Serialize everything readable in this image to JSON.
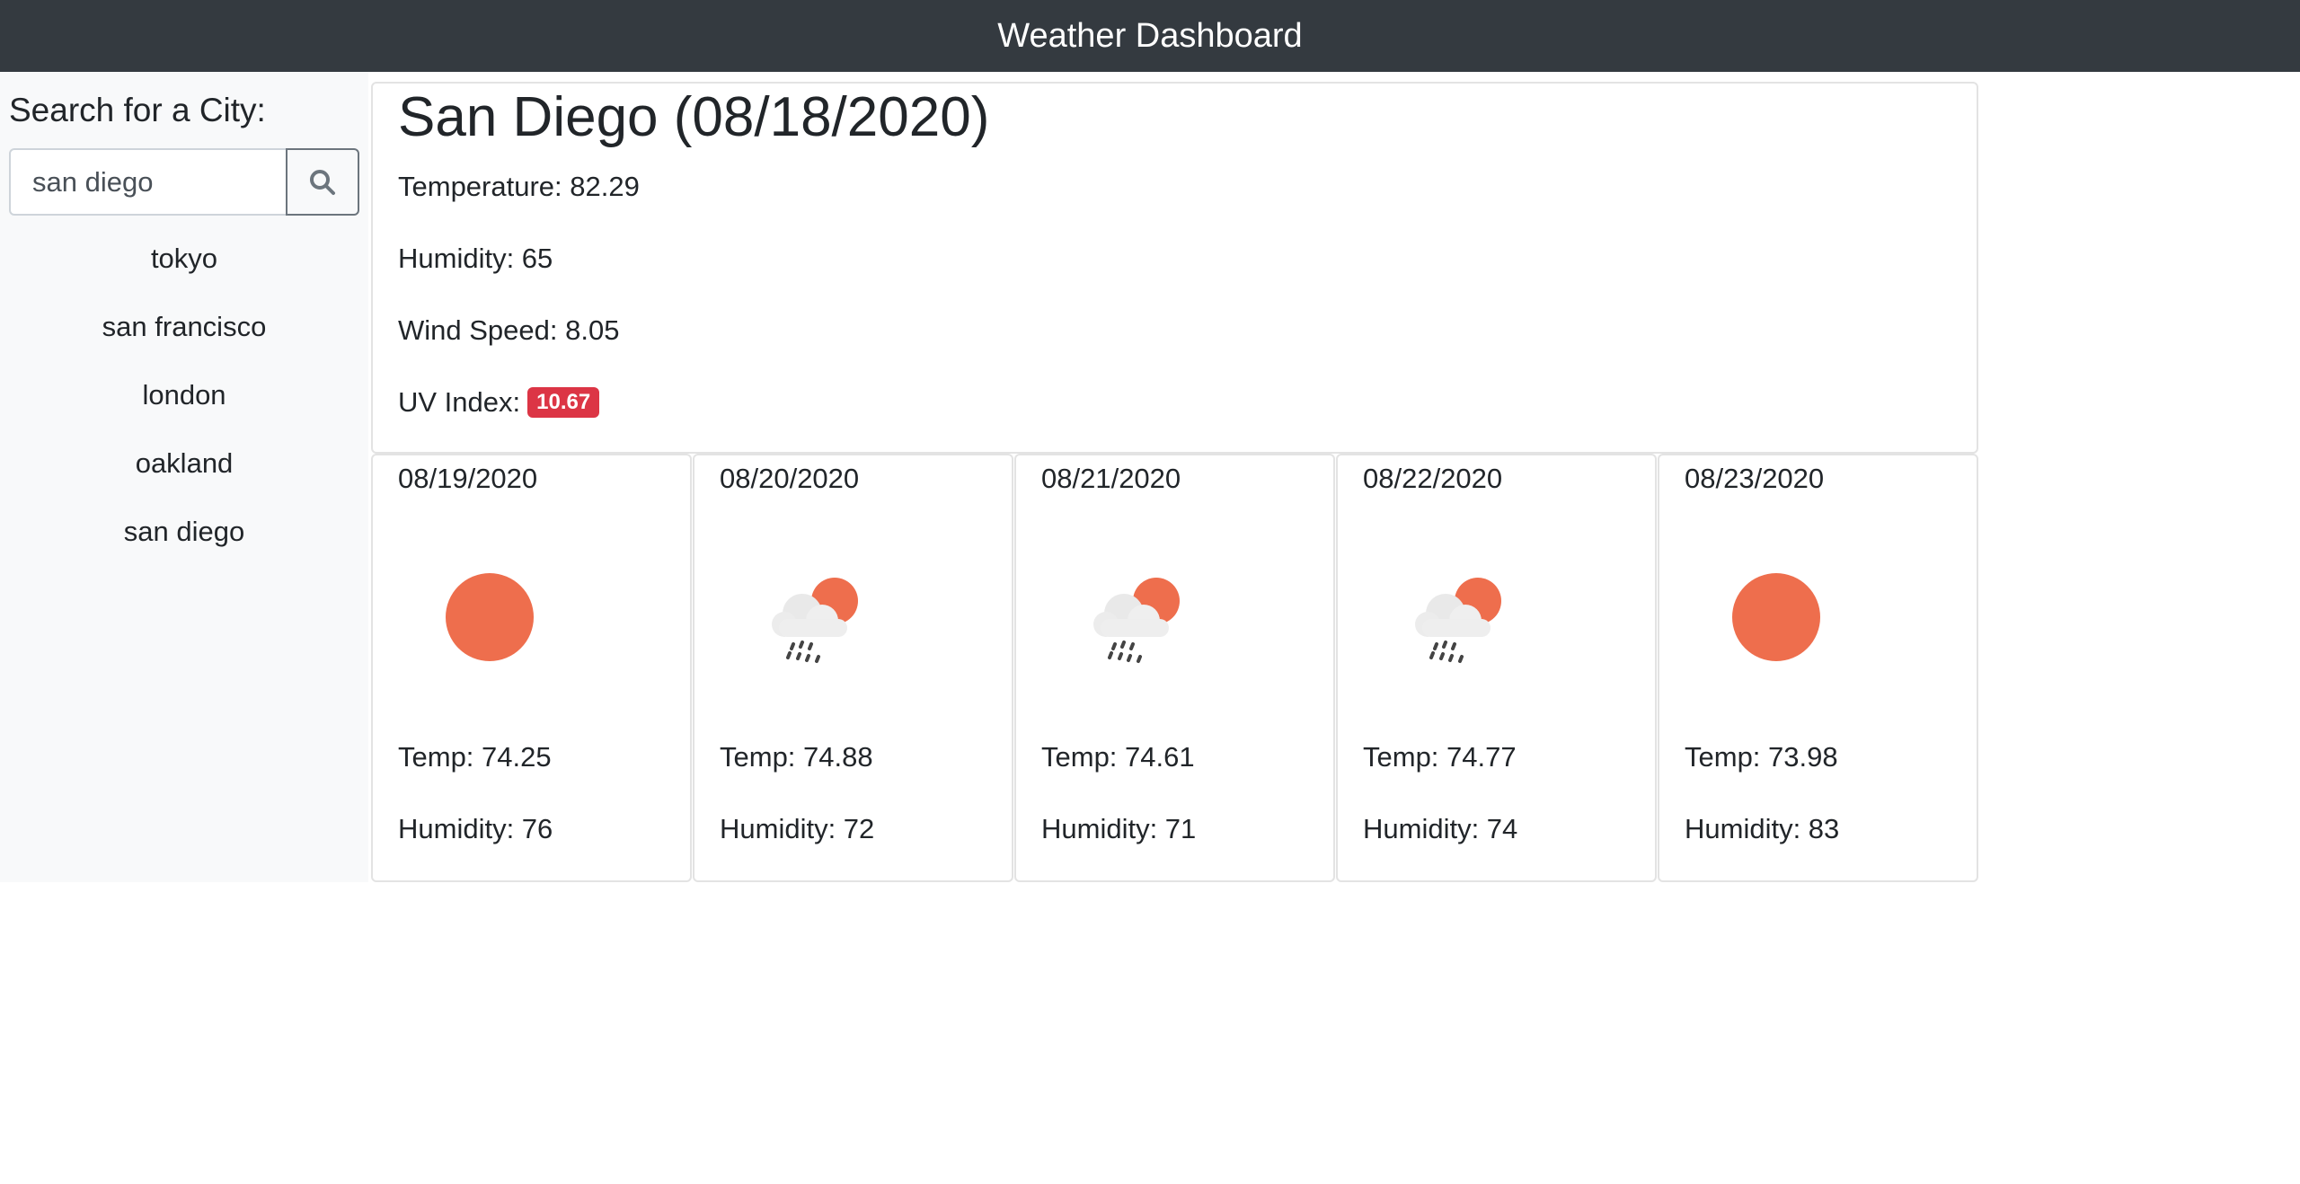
{
  "header": {
    "title": "Weather Dashboard"
  },
  "sidebar": {
    "search_label": "Search for a City:",
    "search_value": "san diego",
    "search_button_icon": "search-icon",
    "history": [
      "tokyo",
      "san francisco",
      "london",
      "oakland",
      "san diego"
    ]
  },
  "current": {
    "title": "San Diego (08/18/2020)",
    "temperature": "Temperature: 82.29",
    "humidity": "Humidity: 65",
    "wind": "Wind Speed: 8.05",
    "uv_label": "UV Index:",
    "uv_value": "10.67",
    "uv_color": "#dc3545"
  },
  "forecast": [
    {
      "date": "08/19/2020",
      "icon": "sun-icon",
      "temp": "Temp: 74.25",
      "humidity": "Humidity: 76"
    },
    {
      "date": "08/20/2020",
      "icon": "rain-cloud-sun-icon",
      "temp": "Temp: 74.88",
      "humidity": "Humidity: 72"
    },
    {
      "date": "08/21/2020",
      "icon": "rain-cloud-sun-icon",
      "temp": "Temp: 74.61",
      "humidity": "Humidity: 71"
    },
    {
      "date": "08/22/2020",
      "icon": "rain-cloud-sun-icon",
      "temp": "Temp: 74.77",
      "humidity": "Humidity: 74"
    },
    {
      "date": "08/23/2020",
      "icon": "sun-icon",
      "temp": "Temp: 73.98",
      "humidity": "Humidity: 83"
    }
  ],
  "colors": {
    "navbar": "#343a40",
    "sun": "#ee6e4d",
    "cloud": "#eeeeee"
  }
}
